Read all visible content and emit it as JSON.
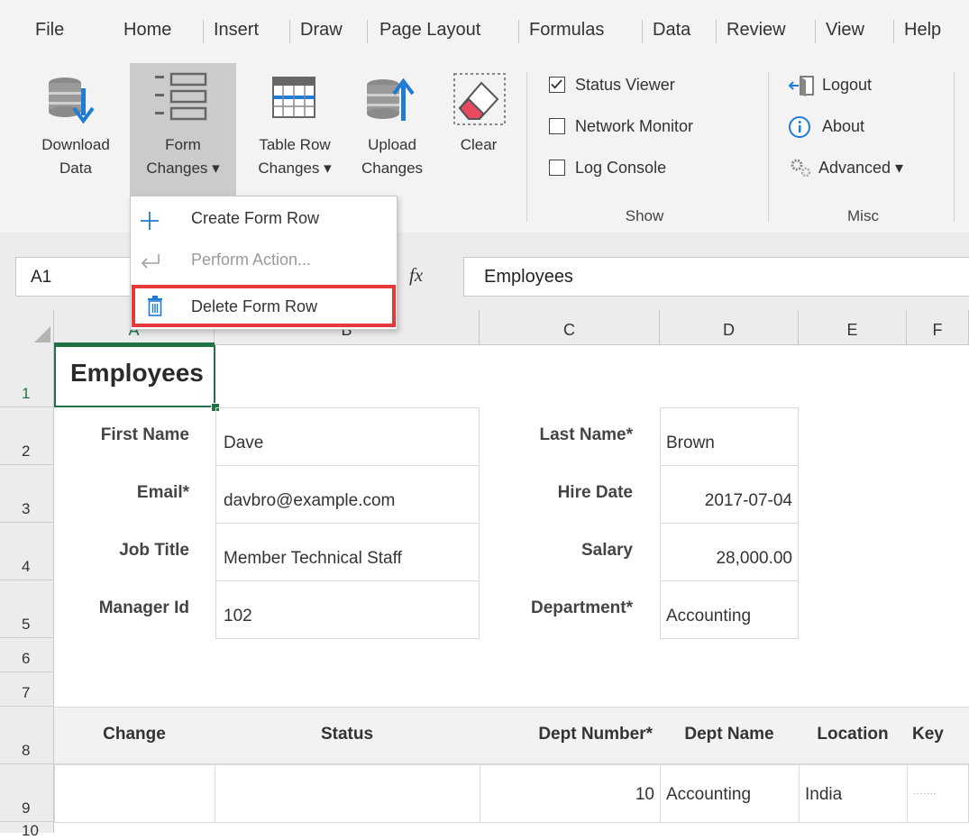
{
  "menu": [
    "File",
    "Home",
    "Insert",
    "Draw",
    "Page Layout",
    "Formulas",
    "Data",
    "Review",
    "View",
    "Help"
  ],
  "ribbon": {
    "download": {
      "line1": "Download",
      "line2": "Data"
    },
    "form_changes": {
      "line1": "Form",
      "line2": "Changes ▾"
    },
    "table_row_changes": {
      "line1": "Table Row",
      "line2": "Changes ▾"
    },
    "upload": {
      "line1": "Upload",
      "line2": "Changes"
    },
    "clear": {
      "line1": "Clear"
    },
    "show": {
      "status_viewer": {
        "label": "Status Viewer",
        "checked": true
      },
      "network_monitor": {
        "label": "Network Monitor",
        "checked": false
      },
      "log_console": {
        "label": "Log Console",
        "checked": false
      },
      "group_label": "Show"
    },
    "misc": {
      "logout": "Logout",
      "about": "About",
      "advanced": "Advanced ▾",
      "group_label": "Misc"
    }
  },
  "dropdown": {
    "create_form_row": "Create Form Row",
    "perform_action": "Perform Action...",
    "delete_form_row": "Delete Form Row"
  },
  "formula_bar": {
    "name_box": "A1",
    "fx": "fx",
    "content": "Employees"
  },
  "columns": [
    "A",
    "B",
    "C",
    "D",
    "E",
    "F"
  ],
  "rows": [
    "1",
    "2",
    "3",
    "4",
    "5",
    "6",
    "7",
    "8",
    "9",
    "10"
  ],
  "sheet": {
    "title": "Employees",
    "first_name_label": "First Name",
    "first_name": "Dave",
    "last_name_label": "Last Name*",
    "last_name": "Brown",
    "email_label": "Email*",
    "email": "davbro@example.com",
    "hire_date_label": "Hire Date",
    "hire_date": "2017-07-04",
    "job_title_label": "Job Title",
    "job_title": "Member Technical Staff",
    "salary_label": "Salary",
    "salary": "28,000.00",
    "manager_id_label": "Manager Id",
    "manager_id": "102",
    "department_label": "Department*",
    "department": "Accounting",
    "table_headers": [
      "Change",
      "Status",
      "Dept Number*",
      "Dept Name",
      "Location",
      "Key"
    ],
    "table_row": {
      "change": "",
      "status": "",
      "dept_number": "10",
      "dept_name": "Accounting",
      "location": "India",
      "key": "......."
    }
  },
  "colors": {
    "selection": "#217346",
    "highlight": "#e8393a"
  }
}
